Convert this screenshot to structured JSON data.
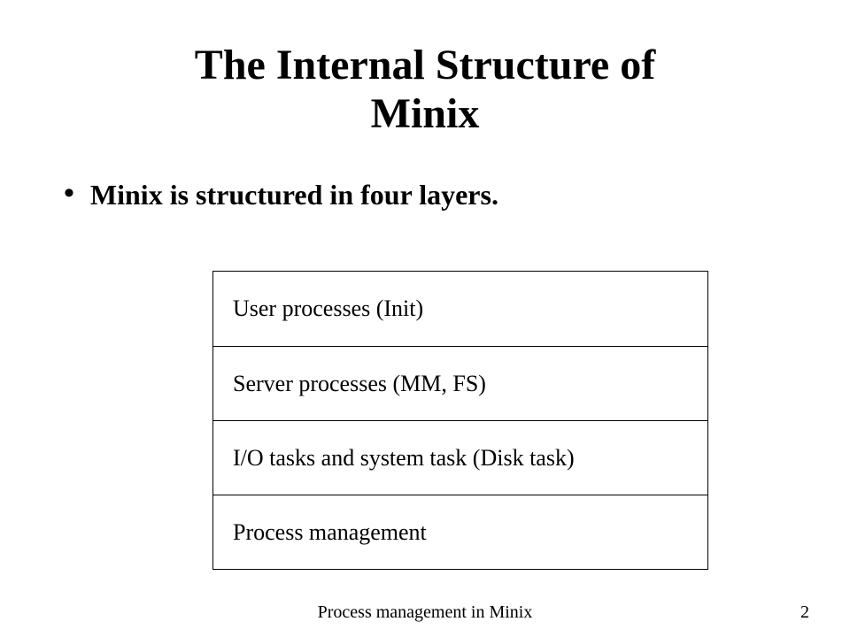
{
  "title_line1": "The Internal Structure of",
  "title_line2": "Minix",
  "bullet": "Minix is structured in four layers.",
  "layers": {
    "r0": "User processes (Init)",
    "r1": "Server processes (MM, FS)",
    "r2": "I/O tasks and system task (Disk task)",
    "r3": "Process management"
  },
  "footer": "Process management in Minix",
  "page_number": "2"
}
